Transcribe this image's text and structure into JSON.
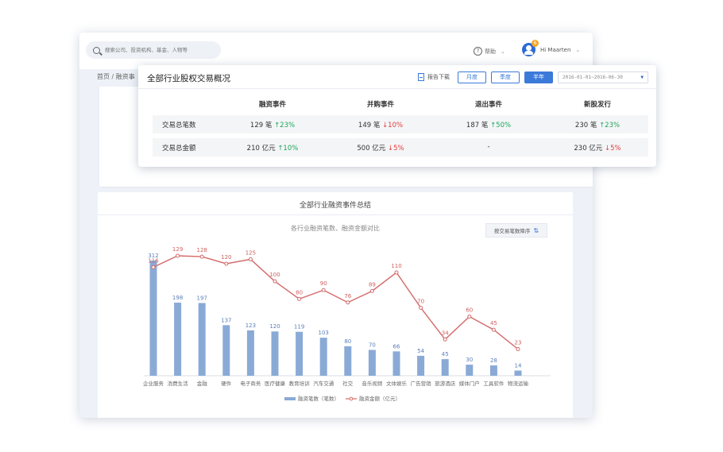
{
  "search": {
    "placeholder": "搜索公司、投资机构、基金、人物等"
  },
  "header": {
    "help_label": "帮助",
    "user_name": "Hi Maarten",
    "notification_count": "6"
  },
  "breadcrumb": "首页 / 融资事",
  "popup": {
    "title": "全部行业股权交易概况",
    "export_label": "报告下载",
    "periods": [
      "月度",
      "季度",
      "半年"
    ],
    "active_period": "半年",
    "date_range": "2016-01-01~2016-06-30",
    "columns": [
      "融资事件",
      "并购事件",
      "退出事件",
      "新股发行"
    ],
    "rows": [
      {
        "label": "交易总笔数",
        "cells": [
          {
            "value": "129 笔",
            "trend": "↑23%",
            "dir": "up"
          },
          {
            "value": "149 笔",
            "trend": "↓10%",
            "dir": "down"
          },
          {
            "value": "187 笔",
            "trend": "↑50%",
            "dir": "up"
          },
          {
            "value": "230 笔",
            "trend": "↑23%",
            "dir": "up"
          }
        ]
      },
      {
        "label": "交易总金额",
        "cells": [
          {
            "value": "210 亿元",
            "trend": "↑10%",
            "dir": "up"
          },
          {
            "value": "500 亿元",
            "trend": "↓5%",
            "dir": "down"
          },
          {
            "value": "-",
            "trend": "",
            "dir": ""
          },
          {
            "value": "230 亿元",
            "trend": "↓5%",
            "dir": "down"
          }
        ]
      }
    ]
  },
  "main": {
    "title": "全部行业融资事件总结",
    "sort_button": "按交易笔数降序"
  },
  "chart_data": {
    "type": "bar",
    "title": "各行业融资笔数、融资金额对比",
    "categories": [
      "企业服务",
      "消费生活",
      "金融",
      "硬件",
      "电子商务",
      "医疗健康",
      "教育培训",
      "汽车交通",
      "社交",
      "音乐视频",
      "文体娱乐",
      "广告营销",
      "旅游酒店",
      "媒体门户",
      "工具软件",
      "物流运输"
    ],
    "series": [
      {
        "name": "融资笔数（笔数）",
        "type": "bar",
        "values": [
          312,
          198,
          197,
          137,
          123,
          120,
          119,
          103,
          80,
          70,
          66,
          54,
          45,
          30,
          28,
          14
        ]
      },
      {
        "name": "融资金额（亿元）",
        "type": "line",
        "values": [
          116,
          129,
          128,
          120,
          125,
          100,
          80,
          90,
          76,
          89,
          110,
          70,
          34,
          60,
          45,
          23
        ]
      }
    ],
    "legend_position": "bottom-center",
    "colors": {
      "bar": "#8aaad6",
      "bar_label": "#5a7fb8",
      "line": "#d46a6a",
      "line_label": "#d06060"
    }
  }
}
